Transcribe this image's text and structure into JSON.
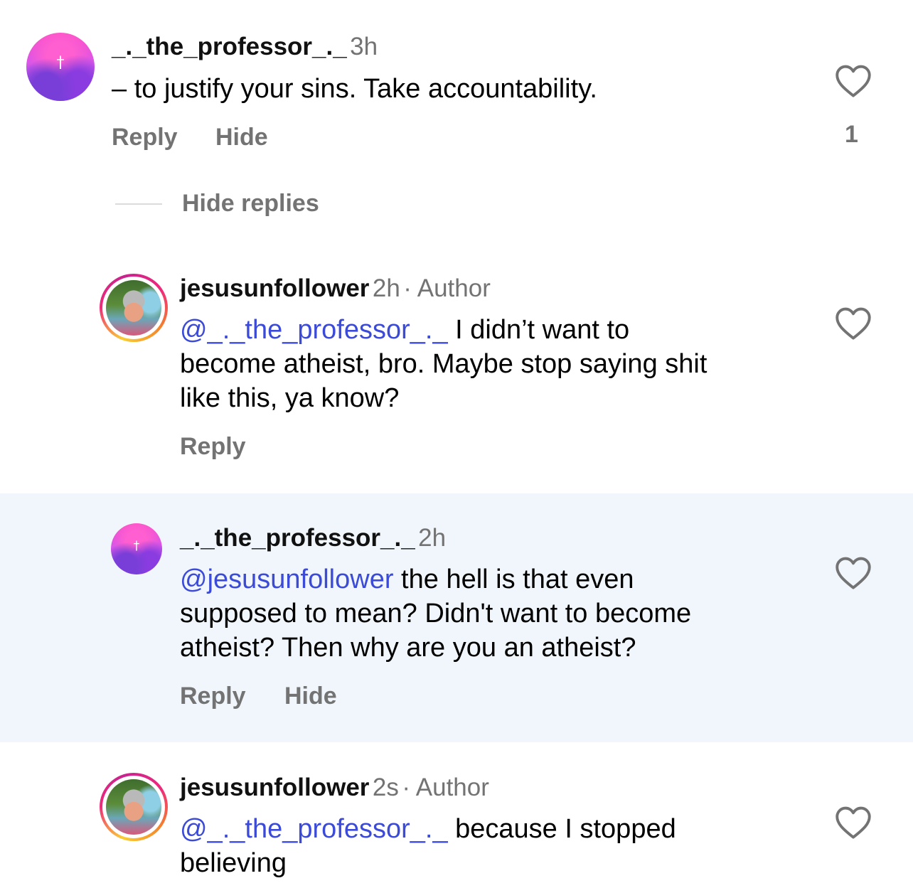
{
  "comments": [
    {
      "username": "_._the_professor_._",
      "time": "3h",
      "text": "– to justify your sins. Take accountability.",
      "reply_label": "Reply",
      "hide_label": "Hide",
      "like_count": "1",
      "hide_replies_label": "Hide replies"
    },
    {
      "username": "jesusunfollower",
      "time": "2h",
      "author_badge": "· Author",
      "mention": "@_._the_professor_._",
      "text_line1": " I didn’t want to",
      "text_line2": "become atheist, bro. Maybe stop saying shit",
      "text_line3": "like this, ya know?",
      "reply_label": "Reply"
    },
    {
      "username": "_._the_professor_._",
      "time": "2h",
      "mention": "@jesusunfollower",
      "text_line1": " the hell is that even",
      "text_line2": "supposed to mean? Didn't want to become",
      "text_line3": "atheist? Then why are you an atheist?",
      "reply_label": "Reply",
      "hide_label": "Hide"
    },
    {
      "username": "jesusunfollower",
      "time": "2s",
      "author_badge": "· Author",
      "mention": "@_._the_professor_._",
      "text_line1": " because I stopped",
      "text_line2": "believing"
    }
  ],
  "icons": {
    "heart": "heart-outline-icon",
    "cross": "†"
  },
  "colors": {
    "mention": "#3b4bd8",
    "muted": "#737373",
    "highlight_bg": "#f0f6fb"
  }
}
